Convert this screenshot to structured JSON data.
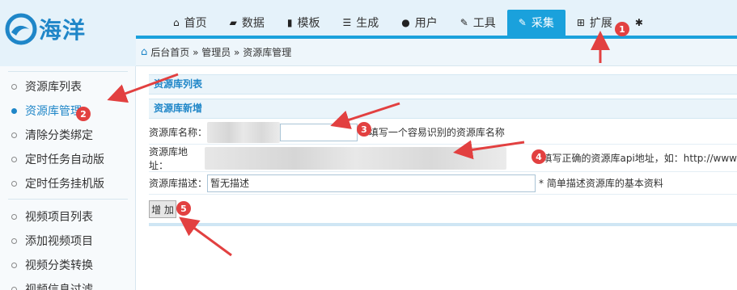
{
  "logo": {
    "text": "海洋",
    "icon": "wave-logo-icon"
  },
  "nav": {
    "items": [
      {
        "label": "首页",
        "icon": "home-icon",
        "glyph": "⌂"
      },
      {
        "label": "数据",
        "icon": "book-icon",
        "glyph": "▰"
      },
      {
        "label": "模板",
        "icon": "file-icon",
        "glyph": "▮"
      },
      {
        "label": "生成",
        "icon": "server-icon",
        "glyph": "☰"
      },
      {
        "label": "用户",
        "icon": "user-icon",
        "glyph": "●"
      },
      {
        "label": "工具",
        "icon": "wrench-icon",
        "glyph": "✎"
      },
      {
        "label": "采集",
        "icon": "edit-icon",
        "glyph": "✎"
      },
      {
        "label": "扩展",
        "icon": "sitemap-icon",
        "glyph": "⊞"
      },
      {
        "label": "",
        "icon": "gear-icon",
        "glyph": "✱"
      }
    ],
    "active_index": 6
  },
  "breadcrumb": {
    "text": "后台首页 » 管理员 » 资源库管理"
  },
  "sidebar": {
    "items": [
      {
        "label": "资源库列表"
      },
      {
        "label": "资源库管理"
      },
      {
        "label": "清除分类绑定"
      },
      {
        "label": "定时任务自动版"
      },
      {
        "label": "定时任务挂机版"
      },
      {
        "label": "视频项目列表"
      },
      {
        "label": "添加视频项目"
      },
      {
        "label": "视频分类转换"
      },
      {
        "label": "视频信息过滤"
      }
    ],
    "active_index": 1
  },
  "panels": {
    "list_title": "资源库列表",
    "add_title": "资源库新增"
  },
  "form": {
    "name_label": "资源库名称：",
    "name_hint": "* 填写一个容易识别的资源库名称",
    "url_label": "资源库地址：",
    "url_hint": "请填写正确的资源库api地址，如：http://www",
    "desc_label": "资源库描述：",
    "desc_value": "暂无描述",
    "desc_hint": "* 简单描述资源库的基本资料",
    "submit_label": "增 加"
  },
  "annotations": [
    "1",
    "2",
    "3",
    "4",
    "5"
  ],
  "colors": {
    "accent": "#1aa1dc",
    "badge": "#e24040",
    "arrow": "#e24040"
  }
}
